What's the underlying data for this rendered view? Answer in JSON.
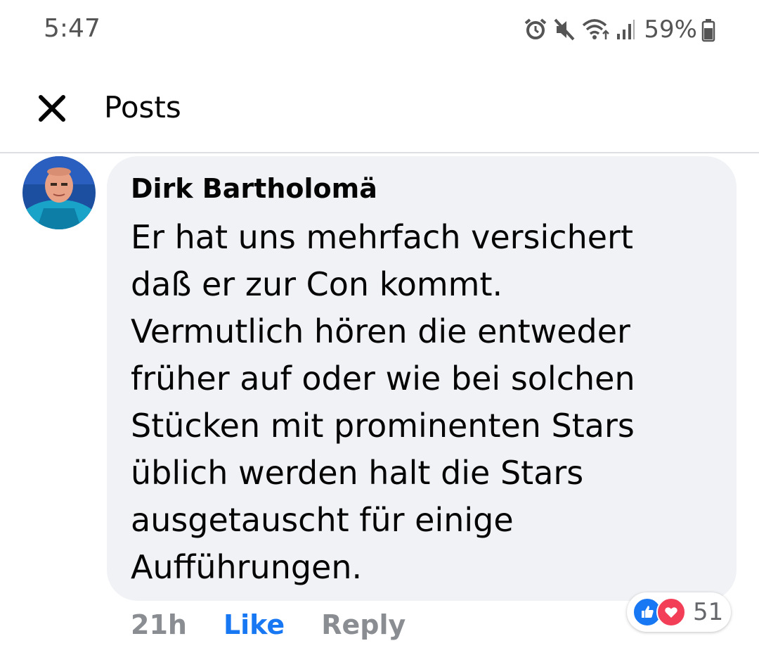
{
  "status_bar": {
    "time": "5:47",
    "battery_percent": "59%",
    "icons": [
      "alarm-icon",
      "mute-icon",
      "wifi-icon",
      "signal-icon",
      "battery-icon"
    ]
  },
  "header": {
    "close_icon": "close-icon",
    "title": "Posts"
  },
  "comment": {
    "author": "Dirk Bartholomä",
    "text": "Er hat uns mehrfach versichert\ndaß er zur Con kommt.\nVermutlich hören die entweder\nfrüher auf oder wie bei solchen\nStücken mit prominenten Stars\nüblich werden halt die Stars\nausgetauscht für einige\nAufführungen.",
    "time_ago": "21h",
    "like_label": "Like",
    "reply_label": "Reply",
    "reactions": {
      "types": [
        "like-icon",
        "love-icon"
      ],
      "count": "51"
    }
  },
  "colors": {
    "accent": "#1877f2",
    "bubble": "#f0f2f5",
    "muted": "#8a8d91",
    "love": "#f33e58"
  }
}
